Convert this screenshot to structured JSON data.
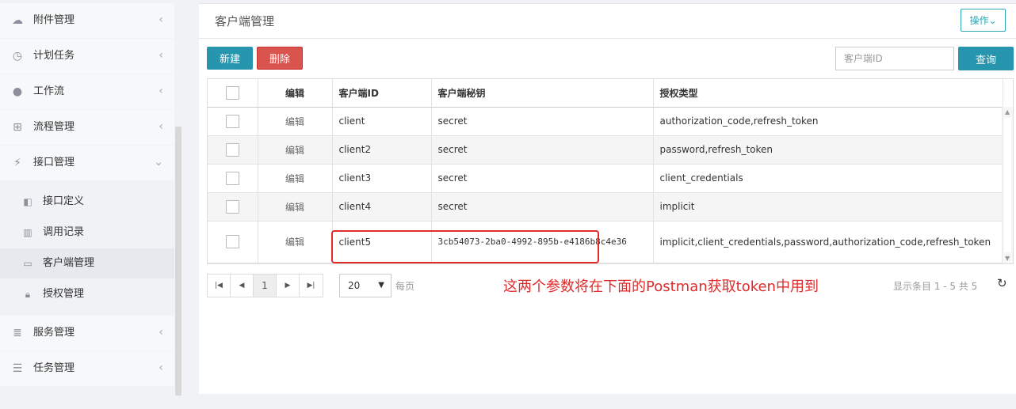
{
  "sidebar": {
    "items": [
      {
        "label": "附件管理",
        "icon": "cloud-upload-icon",
        "chevron": "‹"
      },
      {
        "label": "计划任务",
        "icon": "clock-icon",
        "chevron": "‹"
      },
      {
        "label": "工作流",
        "icon": "user-icon",
        "chevron": "‹"
      },
      {
        "label": "流程管理",
        "icon": "sitemap-icon",
        "chevron": "‹"
      },
      {
        "label": "接口管理",
        "icon": "plug-icon",
        "chevron": "⌄"
      },
      {
        "label": "服务管理",
        "icon": "server-icon",
        "chevron": "‹"
      },
      {
        "label": "任务管理",
        "icon": "tasks-icon",
        "chevron": "‹"
      }
    ],
    "subitems": [
      {
        "label": "接口定义",
        "icon": "share-icon"
      },
      {
        "label": "调用记录",
        "icon": "bar-chart-icon"
      },
      {
        "label": "客户端管理",
        "icon": "laptop-icon"
      },
      {
        "label": "授权管理",
        "icon": "lock-icon"
      }
    ]
  },
  "panel": {
    "title": "客户端管理",
    "op_label": "操作⌄"
  },
  "toolbar": {
    "new_label": "新建",
    "delete_label": "删除",
    "search_placeholder": "客户端ID",
    "query_label": "查询"
  },
  "table": {
    "headers": [
      "编辑",
      "客户端ID",
      "客户端秘钥",
      "授权类型"
    ],
    "rows": [
      {
        "edit": "编辑",
        "client_id": "client",
        "secret": "secret",
        "grant": "authorization_code,refresh_token"
      },
      {
        "edit": "编辑",
        "client_id": "client2",
        "secret": "secret",
        "grant": "password,refresh_token"
      },
      {
        "edit": "编辑",
        "client_id": "client3",
        "secret": "secret",
        "grant": "client_credentials"
      },
      {
        "edit": "编辑",
        "client_id": "client4",
        "secret": "secret",
        "grant": "implicit"
      },
      {
        "edit": "编辑",
        "client_id": "client5",
        "secret": "3cb54073-2ba0-4992-895b-e4186b8c4e36",
        "grant": "implicit,client_credentials,password,authorization_code,refresh_token"
      }
    ]
  },
  "pager": {
    "first": "|◀",
    "prev": "◀",
    "current": "1",
    "next": "▶",
    "last": "▶|",
    "page_size": "20",
    "per_page_label": "每页",
    "info": "显示条目 1 - 5 共 5",
    "refresh": "↻"
  },
  "annotation": "这两个参数将在下面的Postman获取token中用到",
  "colors": {
    "accent": "#2795ad",
    "danger": "#d9534f",
    "annotation": "#e02b2b"
  }
}
